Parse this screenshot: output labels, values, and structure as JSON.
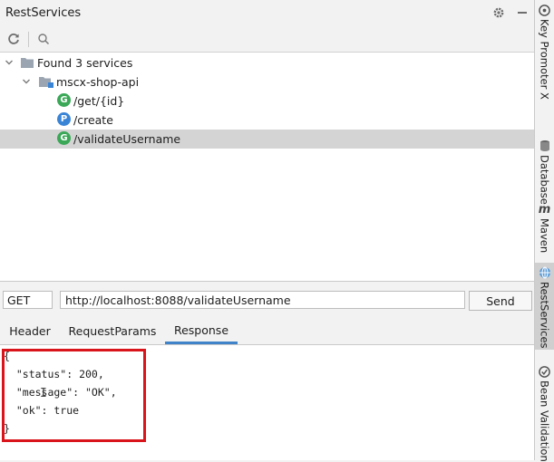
{
  "panel": {
    "title": "RestServices"
  },
  "tree": {
    "root": "Found 3 services",
    "module": "mscx-shop-api",
    "endpoints": [
      {
        "badge": "G",
        "path": "/get/{id}",
        "color": "#3aa857"
      },
      {
        "badge": "P",
        "path": "/create",
        "color": "#3a84d6"
      },
      {
        "badge": "G",
        "path": "/validateUsername",
        "color": "#3aa857",
        "selected": true
      }
    ]
  },
  "request": {
    "method": "GET",
    "url": "http://localhost:8088/validateUsername",
    "send_label": "Send"
  },
  "tabs": [
    {
      "label": "Header"
    },
    {
      "label": "RequestParams"
    },
    {
      "label": "Response",
      "active": true
    }
  ],
  "response": {
    "body": "{\n  \"status\": 200,\n  \"message\": \"OK\",\n  \"ok\": true\n}"
  },
  "sidebar": {
    "items": [
      {
        "label": "Key Promoter X",
        "icon": "key-promoter-icon"
      },
      {
        "label": "Database",
        "icon": "database-icon"
      },
      {
        "label": "Maven",
        "icon": "maven-icon"
      },
      {
        "label": "RestServices",
        "icon": "rest-services-icon",
        "active": true
      },
      {
        "label": "Bean Validation",
        "icon": "bean-validation-icon"
      }
    ]
  },
  "colors": {
    "accent": "#4083c9",
    "highlight": "#d9141a",
    "selected_row": "#d4d4d4"
  }
}
